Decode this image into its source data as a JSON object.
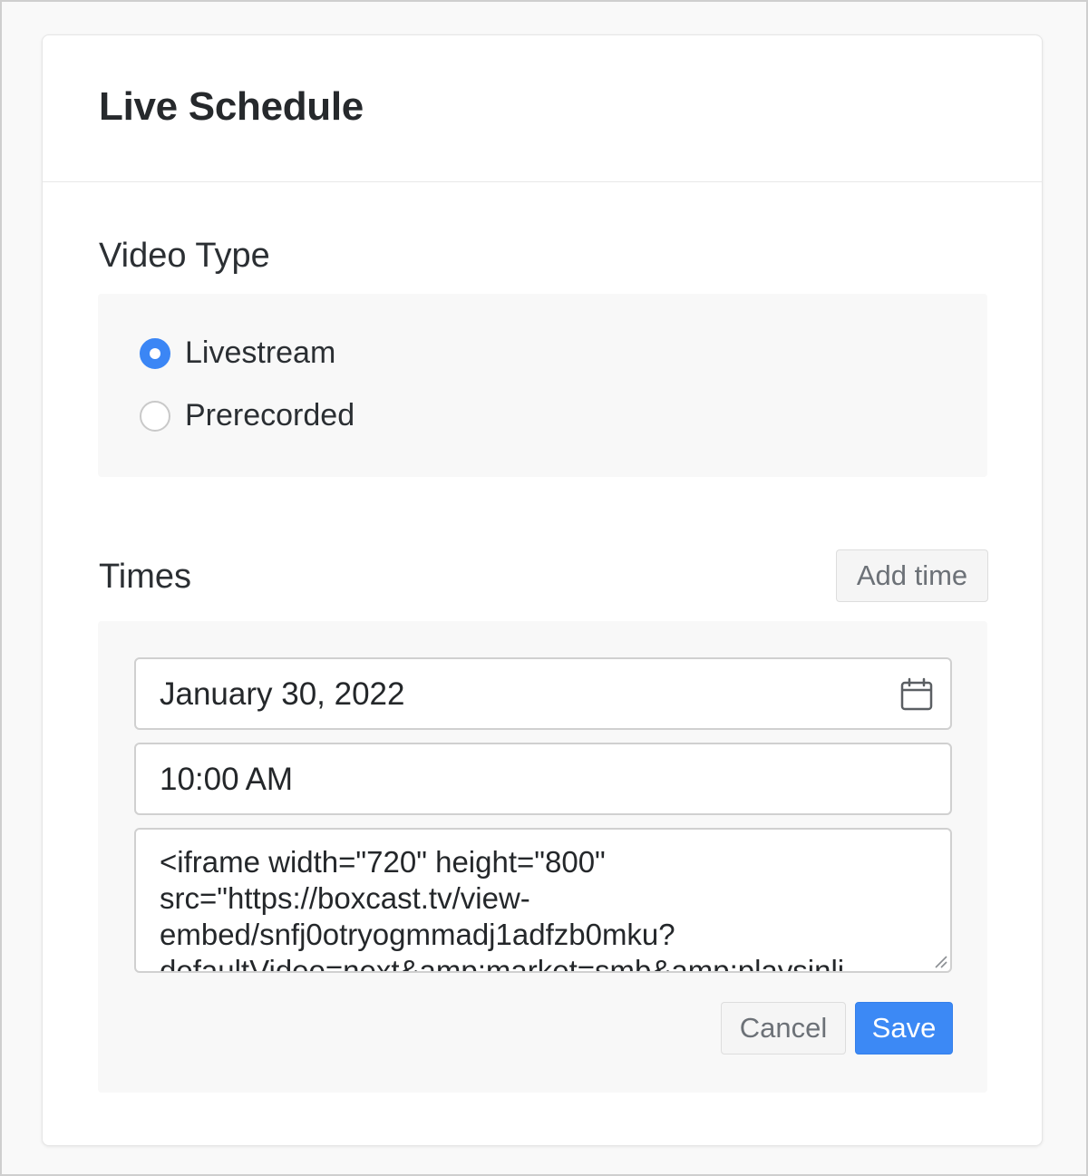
{
  "header": {
    "title": "Live Schedule"
  },
  "video_type": {
    "title": "Video Type",
    "options": [
      {
        "label": "Livestream",
        "checked": true
      },
      {
        "label": "Prerecorded",
        "checked": false
      }
    ]
  },
  "times": {
    "title": "Times",
    "add_label": "Add time",
    "date_value": "January 30, 2022",
    "time_value": "10:00 AM",
    "embed_value": "<iframe width=\"720\" height=\"800\"\nsrc=\"https://boxcast.tv/view-\nembed/snfj0otryogmmadj1adfzb0mku?\ndefaultVideo=next&amp;market=smb&amp;playsinli",
    "cancel_label": "Cancel",
    "save_label": "Save"
  },
  "colors": {
    "accent": "#3b86f5",
    "panel": "#f8f8f8",
    "border": "#d0d0d0"
  },
  "icons": {
    "date": "calendar-icon",
    "textarea": "resize-handle-icon"
  }
}
